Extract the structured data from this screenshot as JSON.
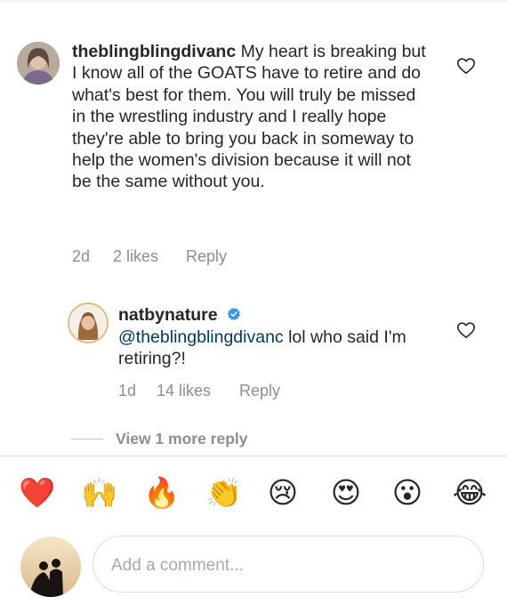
{
  "comments": [
    {
      "username": "theblingblingdivanc",
      "text": "My heart is breaking but I know all of the GOATS have to retire and do what's best for them. You will truly be missed in the wrestling industry and I really hope they're able to bring you back in someway to help the women's division because it will not be the same without you.",
      "time": "2d",
      "likes": "2 likes",
      "reply_label": "Reply"
    },
    {
      "username": "natbynature",
      "mention": "@theblingblingdivanc",
      "text": " lol who said I'm retiring?!",
      "time": "1d",
      "likes": "14 likes",
      "reply_label": "Reply"
    }
  ],
  "view_more_replies": "View 1 more reply",
  "quick_emojis": [
    "❤️",
    "🙌",
    "🔥",
    "👏",
    "😢",
    "😍",
    "😮",
    "😂"
  ],
  "comment_input": {
    "placeholder": "Add a comment..."
  },
  "colors": {
    "text": "#262626",
    "secondary": "#8e8e8e",
    "mention": "#00376b",
    "verified": "#3897f0"
  }
}
